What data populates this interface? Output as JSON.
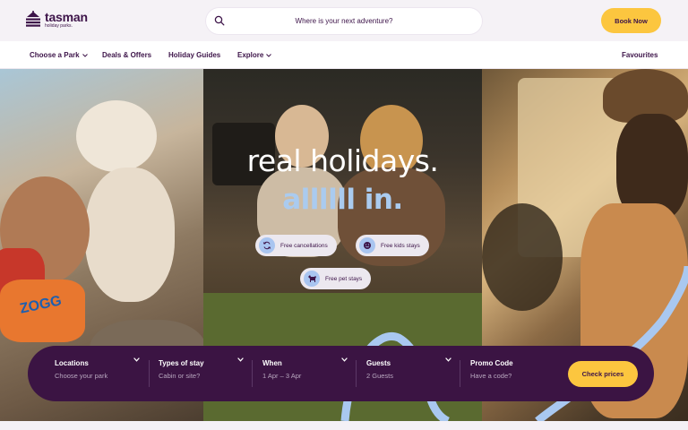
{
  "header": {
    "logo": {
      "name": "tasman",
      "tagline": "holiday parks."
    },
    "search": {
      "placeholder": "Where is your next adventure?"
    },
    "book_now": "Book Now"
  },
  "nav": {
    "items": [
      {
        "label": "Choose a Park",
        "has_dropdown": true
      },
      {
        "label": "Deals & Offers",
        "has_dropdown": false
      },
      {
        "label": "Holiday Guides",
        "has_dropdown": false
      },
      {
        "label": "Explore",
        "has_dropdown": true
      }
    ],
    "favourites": "Favourites"
  },
  "hero": {
    "headline": "real holidays.",
    "subline": "allllll in.",
    "features": [
      {
        "label": "Free cancellations",
        "icon": "refresh-icon"
      },
      {
        "label": "Free kids stays",
        "icon": "smiley-icon"
      },
      {
        "label": "Free pet stays",
        "icon": "dog-icon"
      }
    ],
    "photo_text": "ZOGG"
  },
  "booking": {
    "fields": [
      {
        "label": "Locations",
        "value": "Choose your park",
        "dropdown": true
      },
      {
        "label": "Types of stay",
        "value": "Cabin or site?",
        "dropdown": true
      },
      {
        "label": "When",
        "value": "1 Apr – 3 Apr",
        "dropdown": true
      },
      {
        "label": "Guests",
        "value": "2 Guests",
        "dropdown": true
      },
      {
        "label": "Promo Code",
        "value": "Have a code?",
        "dropdown": false
      }
    ],
    "submit": "Check prices"
  },
  "colors": {
    "brand_purple": "#3b1443",
    "accent_yellow": "#fcc63f",
    "accent_blue": "#aacbef"
  }
}
